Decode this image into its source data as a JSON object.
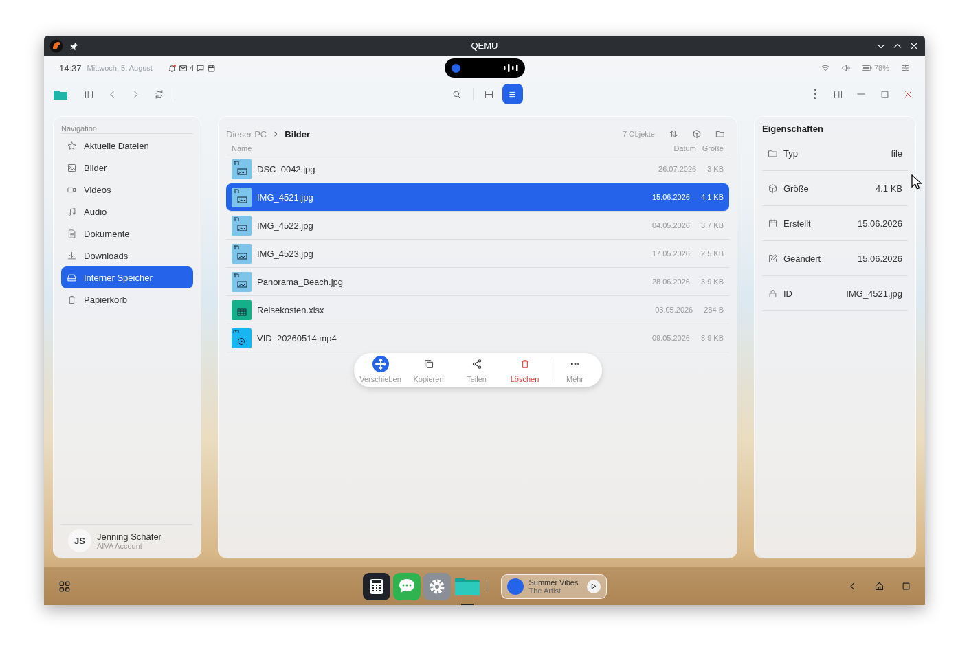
{
  "window": {
    "title": "QEMU"
  },
  "status_bar": {
    "time": "14:37",
    "date": "Mittwoch, 5. August",
    "mail_count": "4",
    "battery": "78%",
    "notification": true
  },
  "toolbar": {
    "views": [
      {
        "kind": "grid",
        "selected": false
      },
      {
        "kind": "list",
        "selected": true
      }
    ]
  },
  "sidebar": {
    "heading": "Navigation",
    "items": [
      {
        "label": "Aktuelle Dateien",
        "kind": "recent",
        "selected": false
      },
      {
        "label": "Bilder",
        "kind": "pictures",
        "selected": false
      },
      {
        "label": "Videos",
        "kind": "videos",
        "selected": false
      },
      {
        "label": "Audio",
        "kind": "audio",
        "selected": false
      },
      {
        "label": "Dokumente",
        "kind": "documents",
        "selected": false
      },
      {
        "label": "Downloads",
        "kind": "downloads",
        "selected": false
      },
      {
        "label": "Interner Speicher",
        "kind": "storage",
        "selected": true
      },
      {
        "label": "Papierkorb",
        "kind": "trash",
        "selected": false
      }
    ],
    "user": {
      "initials": "JS",
      "name": "Jenning Schäfer",
      "account": "AIVA Account"
    }
  },
  "browser": {
    "breadcrumb": [
      "Dieser PC",
      "Bilder"
    ],
    "count": "7 Objekte",
    "columns": [
      "Name",
      "Datum",
      "Größe"
    ],
    "files": [
      {
        "name": "DSC_0042.jpg",
        "kind": "jpg",
        "date": "26.07.2026",
        "size": "3 KB",
        "selected": false
      },
      {
        "name": "IMG_4521.jpg",
        "kind": "jpg",
        "date": "15.06.2026",
        "size": "4.1 KB",
        "selected": true
      },
      {
        "name": "IMG_4522.jpg",
        "kind": "jpg",
        "date": "04.05.2026",
        "size": "3.7 KB",
        "selected": false
      },
      {
        "name": "IMG_4523.jpg",
        "kind": "jpg",
        "date": "17.05.2026",
        "size": "2.5 KB",
        "selected": false
      },
      {
        "name": "Panorama_Beach.jpg",
        "kind": "jpg",
        "date": "28.06.2026",
        "size": "3.9 KB",
        "selected": false
      },
      {
        "name": "Reisekosten.xlsx",
        "kind": "xlsx",
        "date": "03.05.2026",
        "size": "284 B",
        "selected": false
      },
      {
        "name": "VID_20260514.mp4",
        "kind": "mp4",
        "date": "09.05.2026",
        "size": "3.9 KB",
        "selected": false
      }
    ],
    "actions": [
      {
        "label": "Verschieben",
        "kind": "move"
      },
      {
        "label": "Kopieren",
        "kind": "copy"
      },
      {
        "label": "Teilen",
        "kind": "share"
      },
      {
        "label": "Löschen",
        "kind": "delete"
      },
      {
        "label": "Mehr",
        "kind": "more"
      }
    ]
  },
  "properties": {
    "title": "Eigenschaften",
    "rows": [
      {
        "label": "Typ",
        "value": "file",
        "kind": "type"
      },
      {
        "label": "Größe",
        "value": "4.1 KB",
        "kind": "size"
      },
      {
        "label": "Erstellt",
        "value": "15.06.2026",
        "kind": "created"
      },
      {
        "label": "Geändert",
        "value": "15.06.2026",
        "kind": "modified"
      },
      {
        "label": "ID",
        "value": "IMG_4521.jpg",
        "kind": "id"
      }
    ]
  },
  "dock": {
    "apps": [
      {
        "kind": "calculator",
        "running": false
      },
      {
        "kind": "messages",
        "running": false
      },
      {
        "kind": "settings",
        "running": false
      },
      {
        "kind": "files",
        "running": true
      }
    ],
    "media": {
      "title": "Summer Vibes",
      "artist": "The Artist"
    }
  }
}
